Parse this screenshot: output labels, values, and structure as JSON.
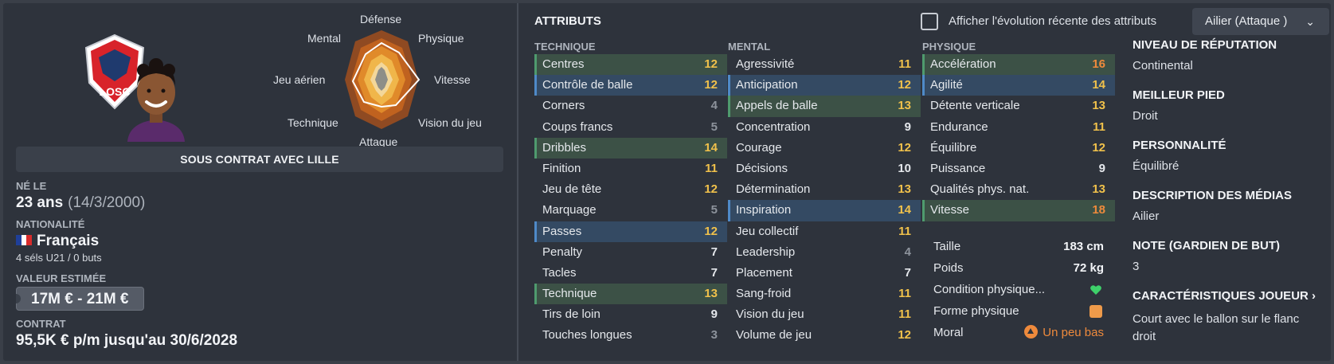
{
  "radar": {
    "labels": {
      "defense": "Défense",
      "physique": "Physique",
      "vitesse": "Vitesse",
      "vision": "Vision du jeu",
      "attaque": "Attaque",
      "technique": "Technique",
      "jeu_aerien": "Jeu aérien",
      "mental": "Mental"
    }
  },
  "logo_text": "LOSC",
  "contract_banner": "SOUS CONTRAT AVEC LILLE",
  "born": {
    "label": "NÉ LE",
    "age": "23 ans",
    "date": "(14/3/2000)"
  },
  "nationality": {
    "label": "NATIONALITÉ",
    "value": "Français",
    "caps": "4 séls U21 / 0 buts",
    "flag_colors": [
      "#1f3f99",
      "#ffffff",
      "#d92b2b"
    ]
  },
  "value": {
    "label": "VALEUR ESTIMÉE",
    "amount": "17M € - 21M €"
  },
  "contract": {
    "label": "CONTRAT",
    "value": "95,5K € p/m jusqu'au 30/6/2028"
  },
  "attributes": {
    "title": "ATTRIBUTS",
    "toggle_label": "Afficher l'évolution récente des attributs",
    "role": "Ailier (Attaque )",
    "columns": [
      {
        "header": "TECHNIQUE",
        "items": [
          {
            "name": "Centres",
            "value": "12",
            "color": "yellow",
            "hl": "green"
          },
          {
            "name": "Contrôle de balle",
            "value": "12",
            "color": "yellow",
            "hl": "blue"
          },
          {
            "name": "Corners",
            "value": "4",
            "color": "gray",
            "hl": ""
          },
          {
            "name": "Coups francs",
            "value": "5",
            "color": "gray",
            "hl": ""
          },
          {
            "name": "Dribbles",
            "value": "14",
            "color": "yellow",
            "hl": "green"
          },
          {
            "name": "Finition",
            "value": "11",
            "color": "yellow",
            "hl": ""
          },
          {
            "name": "Jeu de tête",
            "value": "12",
            "color": "yellow",
            "hl": ""
          },
          {
            "name": "Marquage",
            "value": "5",
            "color": "gray",
            "hl": ""
          },
          {
            "name": "Passes",
            "value": "12",
            "color": "yellow",
            "hl": "blue"
          },
          {
            "name": "Penalty",
            "value": "7",
            "color": "white",
            "hl": ""
          },
          {
            "name": "Tacles",
            "value": "7",
            "color": "white",
            "hl": ""
          },
          {
            "name": "Technique",
            "value": "13",
            "color": "yellow",
            "hl": "green"
          },
          {
            "name": "Tirs de loin",
            "value": "9",
            "color": "white",
            "hl": ""
          },
          {
            "name": "Touches longues",
            "value": "3",
            "color": "gray",
            "hl": ""
          }
        ]
      },
      {
        "header": "MENTAL",
        "items": [
          {
            "name": "Agressivité",
            "value": "11",
            "color": "yellow",
            "hl": ""
          },
          {
            "name": "Anticipation",
            "value": "12",
            "color": "yellow",
            "hl": "blue"
          },
          {
            "name": "Appels de balle",
            "value": "13",
            "color": "yellow",
            "hl": "green"
          },
          {
            "name": "Concentration",
            "value": "9",
            "color": "white",
            "hl": ""
          },
          {
            "name": "Courage",
            "value": "12",
            "color": "yellow",
            "hl": ""
          },
          {
            "name": "Décisions",
            "value": "10",
            "color": "white",
            "hl": ""
          },
          {
            "name": "Détermination",
            "value": "13",
            "color": "yellow",
            "hl": ""
          },
          {
            "name": "Inspiration",
            "value": "14",
            "color": "yellow",
            "hl": "blue"
          },
          {
            "name": "Jeu collectif",
            "value": "11",
            "color": "yellow",
            "hl": ""
          },
          {
            "name": "Leadership",
            "value": "4",
            "color": "gray",
            "hl": ""
          },
          {
            "name": "Placement",
            "value": "7",
            "color": "white",
            "hl": ""
          },
          {
            "name": "Sang-froid",
            "value": "11",
            "color": "yellow",
            "hl": ""
          },
          {
            "name": "Vision du jeu",
            "value": "11",
            "color": "yellow",
            "hl": ""
          },
          {
            "name": "Volume de jeu",
            "value": "12",
            "color": "yellow",
            "hl": ""
          }
        ]
      },
      {
        "header": "PHYSIQUE",
        "items": [
          {
            "name": "Accélération",
            "value": "16",
            "color": "orange",
            "hl": "green"
          },
          {
            "name": "Agilité",
            "value": "14",
            "color": "yellow",
            "hl": "blue"
          },
          {
            "name": "Détente verticale",
            "value": "13",
            "color": "yellow",
            "hl": ""
          },
          {
            "name": "Endurance",
            "value": "11",
            "color": "yellow",
            "hl": ""
          },
          {
            "name": "Équilibre",
            "value": "12",
            "color": "yellow",
            "hl": ""
          },
          {
            "name": "Puissance",
            "value": "9",
            "color": "white",
            "hl": ""
          },
          {
            "name": "Qualités phys. nat.",
            "value": "13",
            "color": "yellow",
            "hl": ""
          },
          {
            "name": "Vitesse",
            "value": "18",
            "color": "orange",
            "hl": "green"
          }
        ]
      }
    ]
  },
  "physical": {
    "height_label": "Taille",
    "height": "183 cm",
    "weight_label": "Poids",
    "weight": "72 kg",
    "condition_label": "Condition physique...",
    "form_label": "Forme physique",
    "morale_label": "Moral",
    "morale": "Un peu bas"
  },
  "profile": {
    "reputation_label": "NIVEAU DE RÉPUTATION",
    "reputation": "Continental",
    "foot_label": "MEILLEUR PIED",
    "foot": "Droit",
    "personality_label": "PERSONNALITÉ",
    "personality": "Équilibré",
    "media_label": "DESCRIPTION DES MÉDIAS",
    "media": "Ailier",
    "gk_label": "NOTE (GARDIEN DE BUT)",
    "gk": "3",
    "traits_label": "CARACTÉRISTIQUES JOUEUR",
    "traits": "Court avec le ballon sur le flanc droit"
  }
}
